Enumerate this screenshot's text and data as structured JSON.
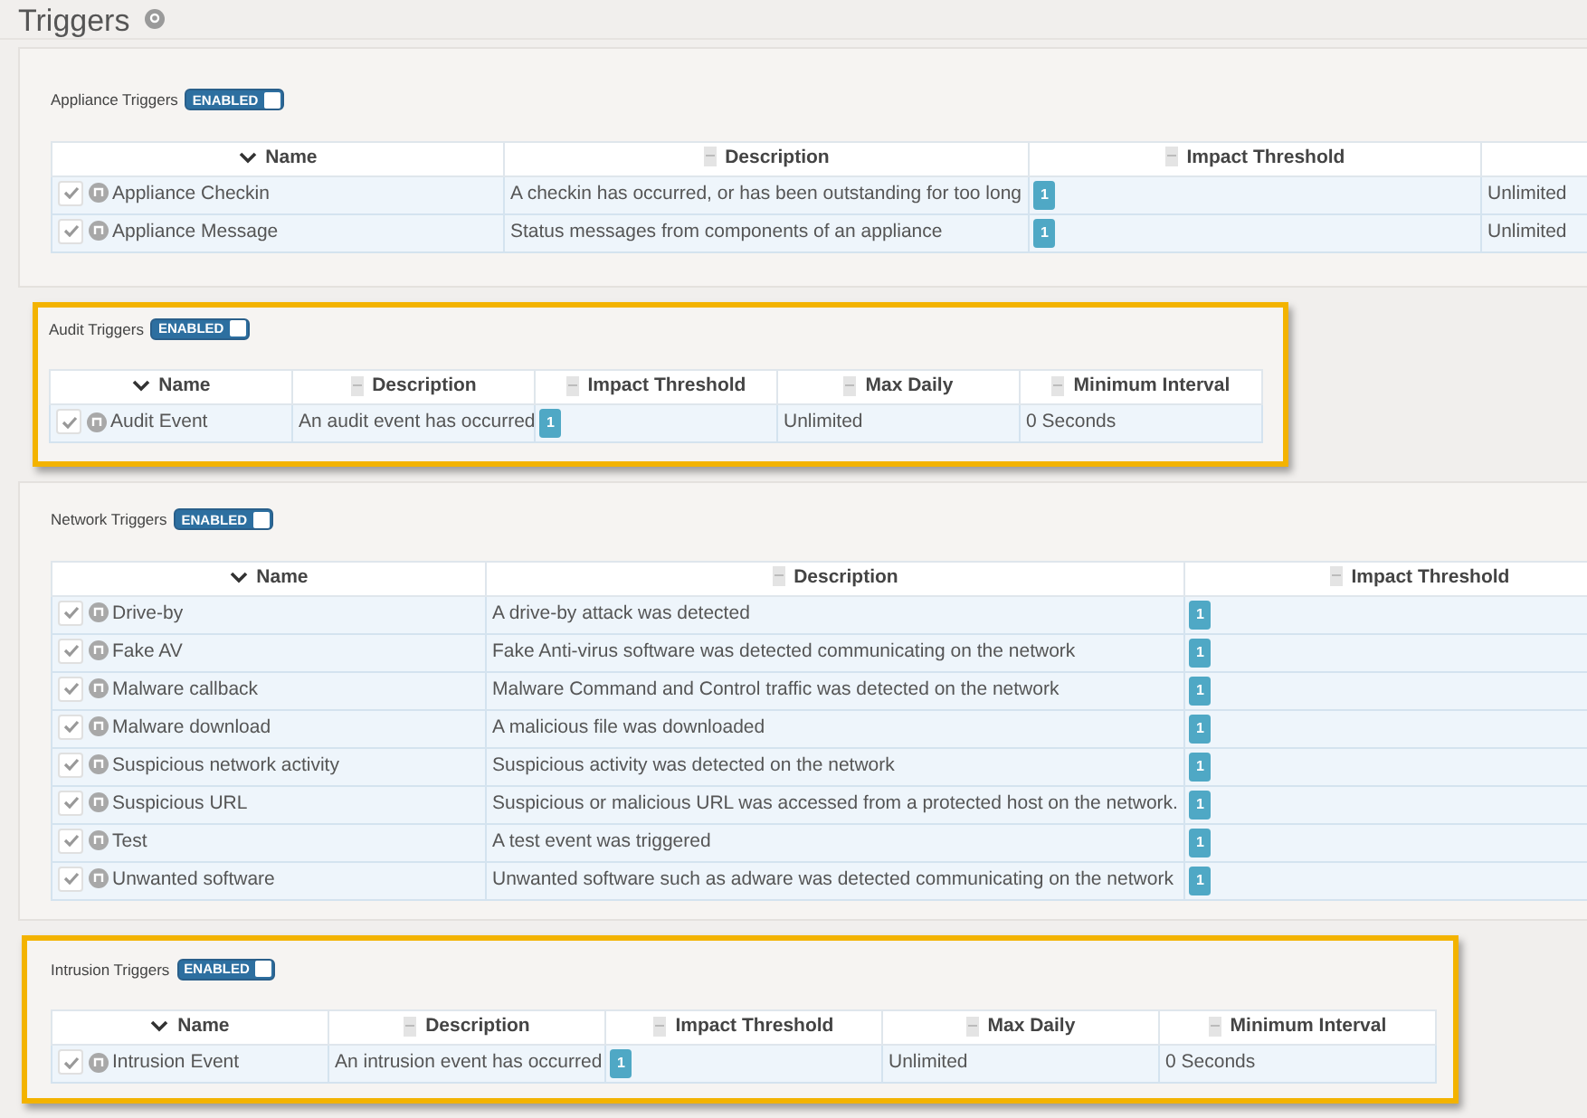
{
  "page": {
    "title": "Triggers"
  },
  "sections": [
    {
      "title": "Appliance Triggers",
      "toggle_label": "ENABLED",
      "enabled": true,
      "highlighted": false,
      "columns": [
        {
          "label": "Name",
          "sorted": true,
          "kind": "name"
        },
        {
          "label": "Description",
          "sorted": false,
          "kind": "text"
        },
        {
          "label": "Impact Threshold",
          "sorted": false,
          "kind": "badge"
        },
        {
          "kind": "text"
        }
      ],
      "rows": [
        {
          "cells": [
            "Appliance Checkin",
            "A checkin has occurred, or has been outstanding for too long",
            "1",
            "Unlimited"
          ]
        },
        {
          "cells": [
            "Appliance Message",
            "Status messages from components of an appliance",
            "1",
            "Unlimited"
          ]
        }
      ]
    },
    {
      "title": "Audit Triggers",
      "toggle_label": "ENABLED",
      "enabled": true,
      "highlighted": true,
      "columns": [
        {
          "label": "Name",
          "sorted": true,
          "kind": "name"
        },
        {
          "label": "Description",
          "sorted": false,
          "kind": "text"
        },
        {
          "label": "Impact Threshold",
          "sorted": false,
          "kind": "badge"
        },
        {
          "label": "Max Daily",
          "sorted": false,
          "kind": "text"
        },
        {
          "label": "Minimum Interval",
          "sorted": false,
          "kind": "text"
        }
      ],
      "rows": [
        {
          "cells": [
            "Audit Event",
            "An audit event has occurred",
            "1",
            "Unlimited",
            "0 Seconds"
          ]
        }
      ]
    },
    {
      "title": "Network Triggers",
      "toggle_label": "ENABLED",
      "enabled": true,
      "highlighted": false,
      "columns": [
        {
          "label": "Name",
          "sorted": true,
          "kind": "name"
        },
        {
          "label": "Description",
          "sorted": false,
          "kind": "text"
        },
        {
          "label": "Impact Threshold",
          "sorted": false,
          "kind": "badge"
        }
      ],
      "rows": [
        {
          "cells": [
            "Drive-by",
            "A drive-by attack was detected",
            "1"
          ]
        },
        {
          "cells": [
            "Fake AV",
            "Fake Anti-virus software was detected communicating on the network",
            "1"
          ]
        },
        {
          "cells": [
            "Malware callback",
            "Malware Command and Control traffic was detected on the network",
            "1"
          ]
        },
        {
          "cells": [
            "Malware download",
            "A malicious file was downloaded",
            "1"
          ]
        },
        {
          "cells": [
            "Suspicious network activity",
            "Suspicious activity was detected on the network",
            "1"
          ]
        },
        {
          "cells": [
            "Suspicious URL",
            "Suspicious or malicious URL was accessed from a protected host on the network.",
            "1"
          ]
        },
        {
          "cells": [
            "Test",
            "A test event was triggered",
            "1"
          ]
        },
        {
          "cells": [
            "Unwanted software",
            "Unwanted software such as adware was detected communicating on the network",
            "1"
          ]
        }
      ]
    },
    {
      "title": "Intrusion Triggers",
      "toggle_label": "ENABLED",
      "enabled": true,
      "highlighted": true,
      "columns": [
        {
          "label": "Name",
          "sorted": true,
          "kind": "name"
        },
        {
          "label": "Description",
          "sorted": false,
          "kind": "text"
        },
        {
          "label": "Impact Threshold",
          "sorted": false,
          "kind": "badge"
        },
        {
          "label": "Max Daily",
          "sorted": false,
          "kind": "text"
        },
        {
          "label": "Minimum Interval",
          "sorted": false,
          "kind": "text"
        }
      ],
      "rows": [
        {
          "cells": [
            "Intrusion Event",
            "An intrusion event has occurred",
            "1",
            "Unlimited",
            "0 Seconds"
          ]
        }
      ]
    }
  ]
}
